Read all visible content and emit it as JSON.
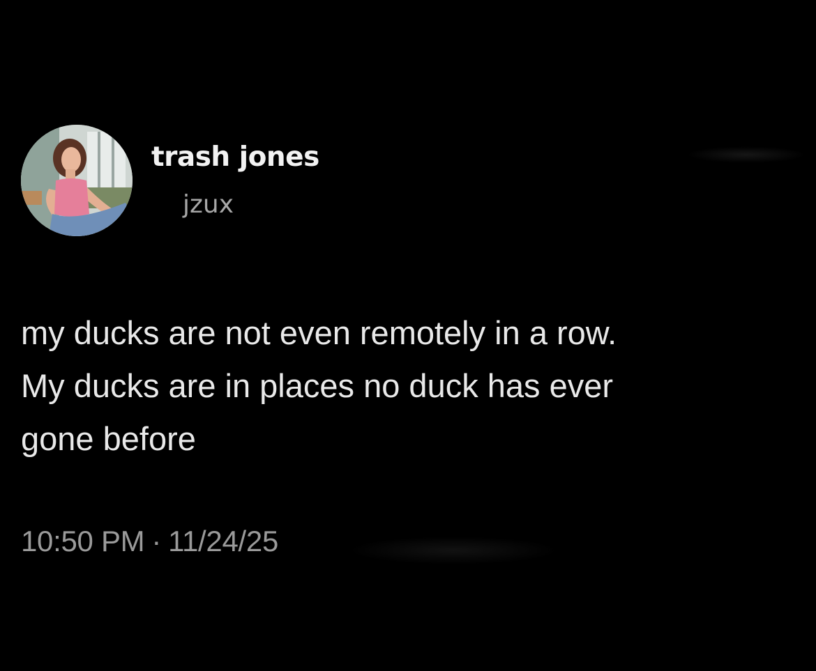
{
  "author": {
    "display_name": "trash jones",
    "handle": "jzux",
    "avatar_icon": "profile-photo"
  },
  "tweet": {
    "lines": [
      "my ducks are not even remotely in a row.",
      "My ducks are in places no duck has ever",
      "gone before"
    ],
    "time": "10:50 PM",
    "separator": "·",
    "date": "11/24/25"
  },
  "colors": {
    "background": "#000000",
    "name": "#f2f2f2",
    "handle": "#a7a7a7",
    "body": "#e9e9e9",
    "meta": "#9a9a9a"
  }
}
